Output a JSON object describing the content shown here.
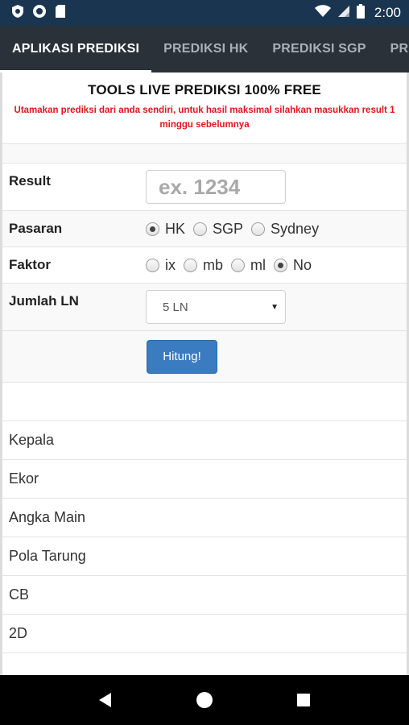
{
  "status_bar": {
    "time": "2:00",
    "left_icons": [
      "shield-icon",
      "circle-icon",
      "sd-card-icon"
    ],
    "right_icons": [
      "wifi-icon",
      "signal-icon",
      "battery-icon"
    ]
  },
  "tabs": [
    {
      "label": "APLIKASI PREDIKSI",
      "active": true
    },
    {
      "label": "PREDIKSI HK",
      "active": false
    },
    {
      "label": "PREDIKSI SGP",
      "active": false
    },
    {
      "label": "PREDI",
      "active": false
    }
  ],
  "header": {
    "title": "TOOLS LIVE PREDIKSI 100% FREE",
    "subtitle": "Utamakan prediksi dari anda sendiri, untuk hasil maksimal silahkan masukkan result 1 minggu sebelumnya"
  },
  "form": {
    "result": {
      "label": "Result",
      "placeholder": "ex. 1234",
      "value": ""
    },
    "pasaran": {
      "label": "Pasaran",
      "options": [
        "HK",
        "SGP",
        "Sydney"
      ],
      "selected": "HK"
    },
    "faktor": {
      "label": "Faktor",
      "options": [
        "ix",
        "mb",
        "ml",
        "No"
      ],
      "selected": "No"
    },
    "jumlah_ln": {
      "label": "Jumlah LN",
      "selected": "5 LN"
    },
    "submit_label": "Hitung!"
  },
  "results": [
    "Kepala",
    "Ekor",
    "Angka Main",
    "Pola Tarung",
    "CB",
    "2D"
  ],
  "colors": {
    "status_bar": "#1a3550",
    "tab_bar": "#2a3138",
    "notice_red": "#e4161b",
    "button_blue": "#3b7bc0"
  }
}
